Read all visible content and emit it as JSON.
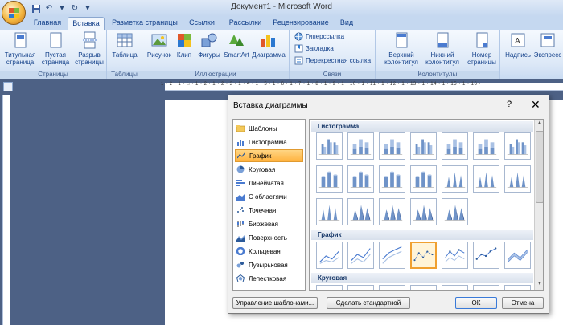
{
  "window": {
    "title": "Документ1 - Microsoft Word"
  },
  "colors": {
    "accent": "#15428b",
    "selected": "#ffb340",
    "doc_bg": "#4d6185"
  },
  "tabs": [
    {
      "label": "Главная"
    },
    {
      "label": "Вставка"
    },
    {
      "label": "Разметка страницы"
    },
    {
      "label": "Ссылки"
    },
    {
      "label": "Рассылки"
    },
    {
      "label": "Рецензирование"
    },
    {
      "label": "Вид"
    }
  ],
  "ribbon": {
    "pages": {
      "label": "Страницы",
      "cover": "Титульная\nстраница",
      "blank": "Пустая\nстраница",
      "break": "Разрыв\nстраницы"
    },
    "tables": {
      "label": "Таблицы",
      "table": "Таблица"
    },
    "illustrations": {
      "label": "Иллюстрации",
      "picture": "Рисунок",
      "clip": "Клип",
      "shapes": "Фигуры",
      "smartart": "SmartArt",
      "chart": "Диаграмма"
    },
    "links": {
      "label": "Связи",
      "hyperlink": "Гиперссылка",
      "bookmark": "Закладка",
      "crossref": "Перекрестная ссылка"
    },
    "headers": {
      "label": "Колонтитулы",
      "header": "Верхний\nколонтитул",
      "footer": "Нижний\nколонтитул",
      "pagenum": "Номер\nстраницы"
    },
    "text": {
      "textbox": "Надпись",
      "express": "Экспресс"
    }
  },
  "ruler": {
    "text": "1 · 2 · 1 · ⌂ · 1 · 2 · 1 · 2 · 3 · 1 · 4 · 1 · 5 · 1 · 6 · 1 · 7 · 1 · 8 · 1 · 9 · 1 · 10 · 1 · 11 · 1 · 12 · 1 · 13 · 1 · 14 · 1 · 15 · 1 · 16 ·"
  },
  "dialog": {
    "title": "Вставка диаграммы",
    "help": "?",
    "close": "✕",
    "categories": [
      {
        "label": "Шаблоны",
        "icon": "folder-icon"
      },
      {
        "label": "Гистограмма",
        "icon": "column-chart-icon"
      },
      {
        "label": "График",
        "icon": "line-chart-icon",
        "selected": true
      },
      {
        "label": "Круговая",
        "icon": "pie-chart-icon"
      },
      {
        "label": "Линейчатая",
        "icon": "bar-chart-icon"
      },
      {
        "label": "С областями",
        "icon": "area-chart-icon"
      },
      {
        "label": "Точечная",
        "icon": "scatter-chart-icon"
      },
      {
        "label": "Биржевая",
        "icon": "stock-chart-icon"
      },
      {
        "label": "Поверхность",
        "icon": "surface-chart-icon"
      },
      {
        "label": "Кольцевая",
        "icon": "doughnut-chart-icon"
      },
      {
        "label": "Пузырьковая",
        "icon": "bubble-chart-icon"
      },
      {
        "label": "Лепестковая",
        "icon": "radar-chart-icon"
      }
    ],
    "sections": {
      "column": "Гистограмма",
      "line": "График",
      "pie": "Круговая"
    },
    "buttons": {
      "manage": "Управление шаблонами...",
      "set_default": "Сделать стандартной",
      "ok": "ОК",
      "cancel": "Отмена"
    }
  }
}
